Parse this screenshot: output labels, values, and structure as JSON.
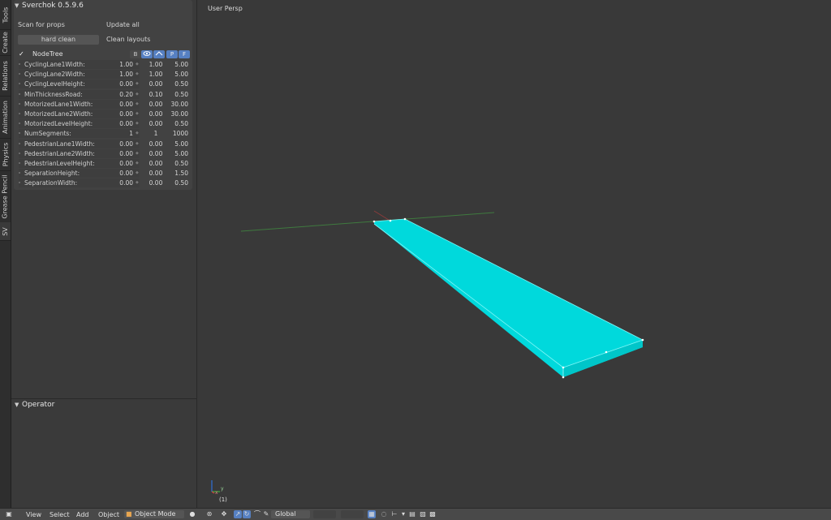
{
  "vtabs": [
    "Tools",
    "Create",
    "Relations",
    "Animation",
    "Physics",
    "Grease Pencil",
    "SV"
  ],
  "sverchok": {
    "title": "Sverchok 0.5.9.6",
    "scan_label": "Scan for props",
    "update_label": "Update all",
    "hard_clean_label": "hard clean",
    "clean_layouts_label": "Clean layouts"
  },
  "tree": {
    "check": "✓",
    "name": "NodeTree",
    "flags": [
      "B",
      "P",
      "F"
    ]
  },
  "props": [
    {
      "name": "CyclingLane1Width:",
      "value": "1.00",
      "min": "1.00",
      "max": "5.00"
    },
    {
      "name": "CyclingLane2Width:",
      "value": "1.00",
      "min": "1.00",
      "max": "5.00"
    },
    {
      "name": "CyclingLevelHeight:",
      "value": "0.00",
      "min": "0.00",
      "max": "0.50"
    },
    {
      "name": "MinThicknessRoad:",
      "value": "0.20",
      "min": "0.10",
      "max": "0.50"
    },
    {
      "name": "MotorizedLane1Width:",
      "value": "0.00",
      "min": "0.00",
      "max": "30.00"
    },
    {
      "name": "MotorizedLane2Width:",
      "value": "0.00",
      "min": "0.00",
      "max": "30.00"
    },
    {
      "name": "MotorizedLevelHeight:",
      "value": "0.00",
      "min": "0.00",
      "max": "0.50"
    },
    {
      "name": "NumSegments:",
      "value": "1",
      "min": "1",
      "max": "1000"
    },
    {
      "name": "PedestrianLane1Width:",
      "value": "0.00",
      "min": "0.00",
      "max": "5.00"
    },
    {
      "name": "PedestrianLane2Width:",
      "value": "0.00",
      "min": "0.00",
      "max": "5.00"
    },
    {
      "name": "PedestrianLevelHeight:",
      "value": "0.00",
      "min": "0.00",
      "max": "0.50"
    },
    {
      "name": "SeparationHeight:",
      "value": "0.00",
      "min": "0.00",
      "max": "1.50"
    },
    {
      "name": "SeparationWidth:",
      "value": "0.00",
      "min": "0.00",
      "max": "0.50"
    }
  ],
  "operator": {
    "title": "Operator"
  },
  "viewport": {
    "label": "User Persp",
    "frame": "(1)",
    "axis_y": "y",
    "axis_x": "x",
    "mesh_color": "#00dde0"
  },
  "bottombar": {
    "view": "View",
    "select": "Select",
    "add": "Add",
    "object": "Object",
    "mode": "Object Mode",
    "orientation": "Global"
  }
}
